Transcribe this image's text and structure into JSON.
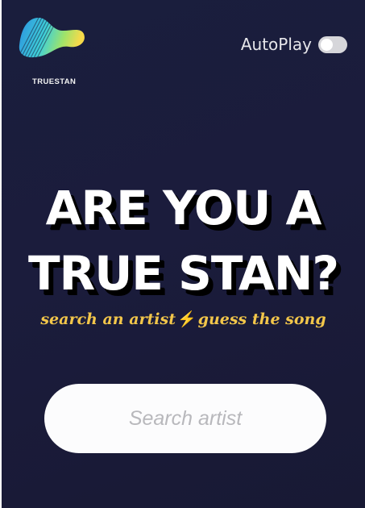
{
  "brand": {
    "name": "TRUESTAN",
    "logo_icon": "wave-logo-icon",
    "colors": [
      "#3ad0e0",
      "#7fe07a",
      "#f4d84c",
      "#2a9fe0"
    ]
  },
  "autoplay": {
    "label": "AutoPlay",
    "enabled": false
  },
  "hero": {
    "line1": "ARE YOU A",
    "line2": "TRUE STAN?",
    "tagline_part1": "search an artist",
    "tagline_icon": "⚡",
    "tagline_part2": "guess the song",
    "accent_color": "#f2c64a"
  },
  "search": {
    "placeholder": "Search artist",
    "value": ""
  }
}
